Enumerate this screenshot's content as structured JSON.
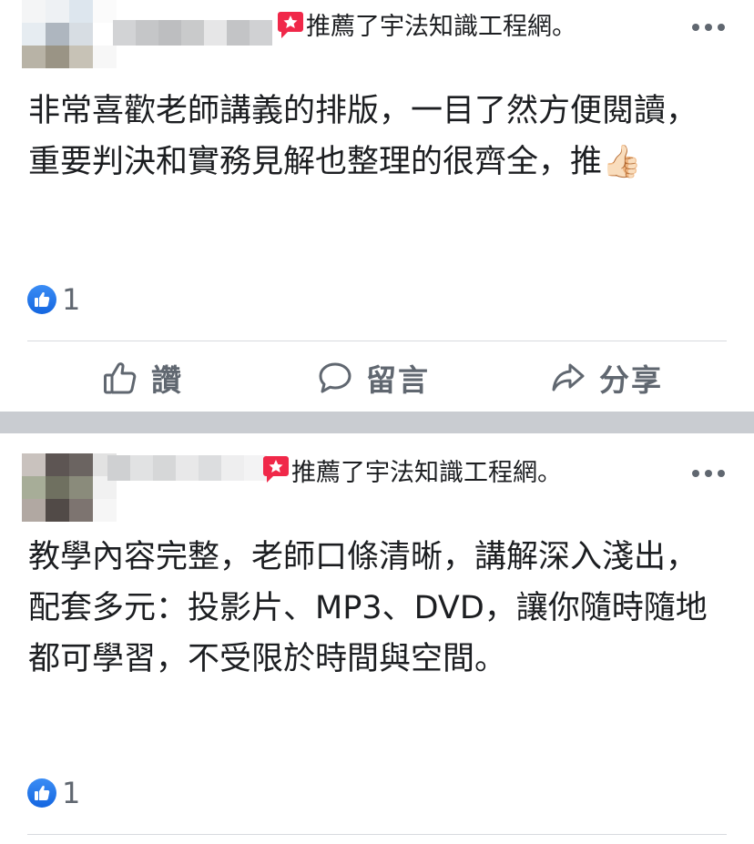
{
  "posts": [
    {
      "recommend_text": "推薦了宇法知識工程網。",
      "body": "非常喜歡老師講義的排版，一目了然方便閱讀，重要判決和實務見解也整理的很齊全，推👍🏻",
      "like_count": "1",
      "actions": {
        "like": "讚",
        "comment": "留言",
        "share": "分享"
      }
    },
    {
      "recommend_text": "推薦了宇法知識工程網。",
      "body": "教學內容完整，老師口條清晰，講解深入淺出，配套多元：投影片、MP3、DVD，讓你隨時隨地都可學習，不受限於時間與空間。",
      "like_count": "1"
    }
  ],
  "colors": {
    "recommend_red": "#f02849",
    "like_blue": "#1877f2",
    "muted_gray": "#606770",
    "separator": "#c9ccd1"
  },
  "icons": {
    "recommend": "recommend-star-icon",
    "more": "more-options-icon",
    "reaction": "like-reaction-icon",
    "like": "thumbs-up-outline-icon",
    "comment": "speech-bubble-icon",
    "share": "share-arrow-icon"
  }
}
